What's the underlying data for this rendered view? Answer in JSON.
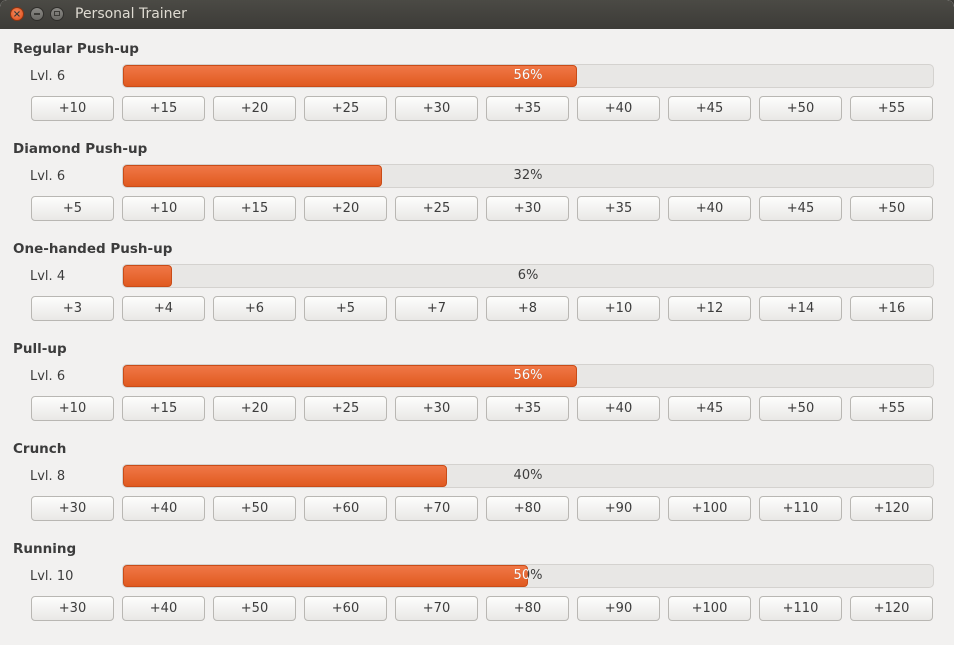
{
  "window": {
    "title": "Personal Trainer"
  },
  "exercises": [
    {
      "name": "Regular Push-up",
      "level": "Lvl. 6",
      "percent_label": "56%",
      "progress": 0.56,
      "increments": [
        "+10",
        "+15",
        "+20",
        "+25",
        "+30",
        "+35",
        "+40",
        "+45",
        "+50",
        "+55"
      ]
    },
    {
      "name": "Diamond Push-up",
      "level": "Lvl. 6",
      "percent_label": "32%",
      "progress": 0.32,
      "increments": [
        "+5",
        "+10",
        "+15",
        "+20",
        "+25",
        "+30",
        "+35",
        "+40",
        "+45",
        "+50"
      ]
    },
    {
      "name": "One-handed Push-up",
      "level": "Lvl. 4",
      "percent_label": "6%",
      "progress": 0.06,
      "increments": [
        "+3",
        "+4",
        "+6",
        "+5",
        "+7",
        "+8",
        "+10",
        "+12",
        "+14",
        "+16"
      ]
    },
    {
      "name": "Pull-up",
      "level": "Lvl. 6",
      "percent_label": "56%",
      "progress": 0.56,
      "increments": [
        "+10",
        "+15",
        "+20",
        "+25",
        "+30",
        "+35",
        "+40",
        "+45",
        "+50",
        "+55"
      ]
    },
    {
      "name": "Crunch",
      "level": "Lvl. 8",
      "percent_label": "40%",
      "progress": 0.4,
      "increments": [
        "+30",
        "+40",
        "+50",
        "+60",
        "+70",
        "+80",
        "+90",
        "+100",
        "+110",
        "+120"
      ]
    },
    {
      "name": "Running",
      "level": "Lvl. 10",
      "percent_label": "50%",
      "progress": 0.5,
      "increments": [
        "+30",
        "+40",
        "+50",
        "+60",
        "+70",
        "+80",
        "+90",
        "+100",
        "+110",
        "+120"
      ]
    }
  ],
  "colors": {
    "accent": "#e9652f",
    "titlebar": "#3c3b37",
    "background": "#f2f1f0"
  }
}
